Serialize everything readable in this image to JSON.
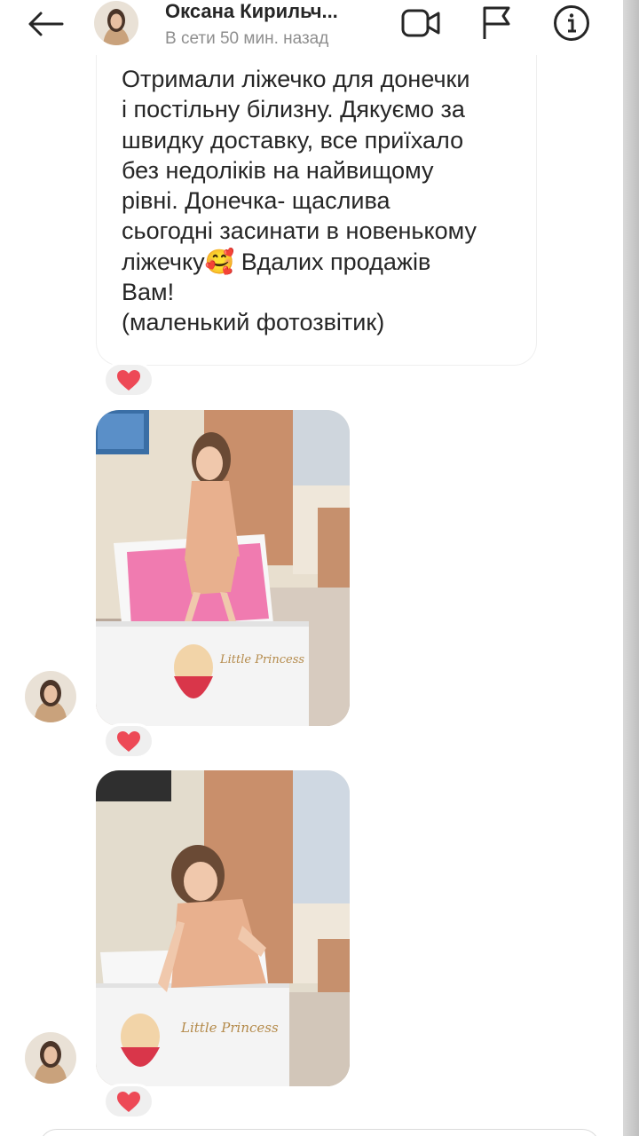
{
  "header": {
    "contact_name": "Оксана Кирильч...",
    "status": "В сети 50 мин. назад",
    "icons": [
      "back-arrow-icon",
      "video-call-icon",
      "report-flag-icon",
      "info-icon"
    ]
  },
  "message": {
    "text": "Отримали ліжечко для донечки\nі постільну білизну. Дякуємо за\nшвидку доставку, все приїхало\nбез недоліків на найвищому\nрівні. Донечка- щаслива\nсьогодні засинати в новенькому\nліжечку🥰 Вдалих продажів\nВам!\n(маленький фотозвітик)",
    "reaction": "❤️"
  },
  "photos": [
    {
      "alt_icon": "photo-girl-standing-on-bed",
      "reaction": "❤️",
      "bed_text": "Little Princess"
    },
    {
      "alt_icon": "photo-girl-posing-on-bed",
      "reaction": "❤️",
      "bed_text": "Little Princess"
    }
  ],
  "colors": {
    "heart": "#ed4956",
    "wall": "#e6dccb",
    "curtain": "#c98f6b",
    "sheet": "#f07bb0",
    "pajama": "#e8b08e"
  }
}
